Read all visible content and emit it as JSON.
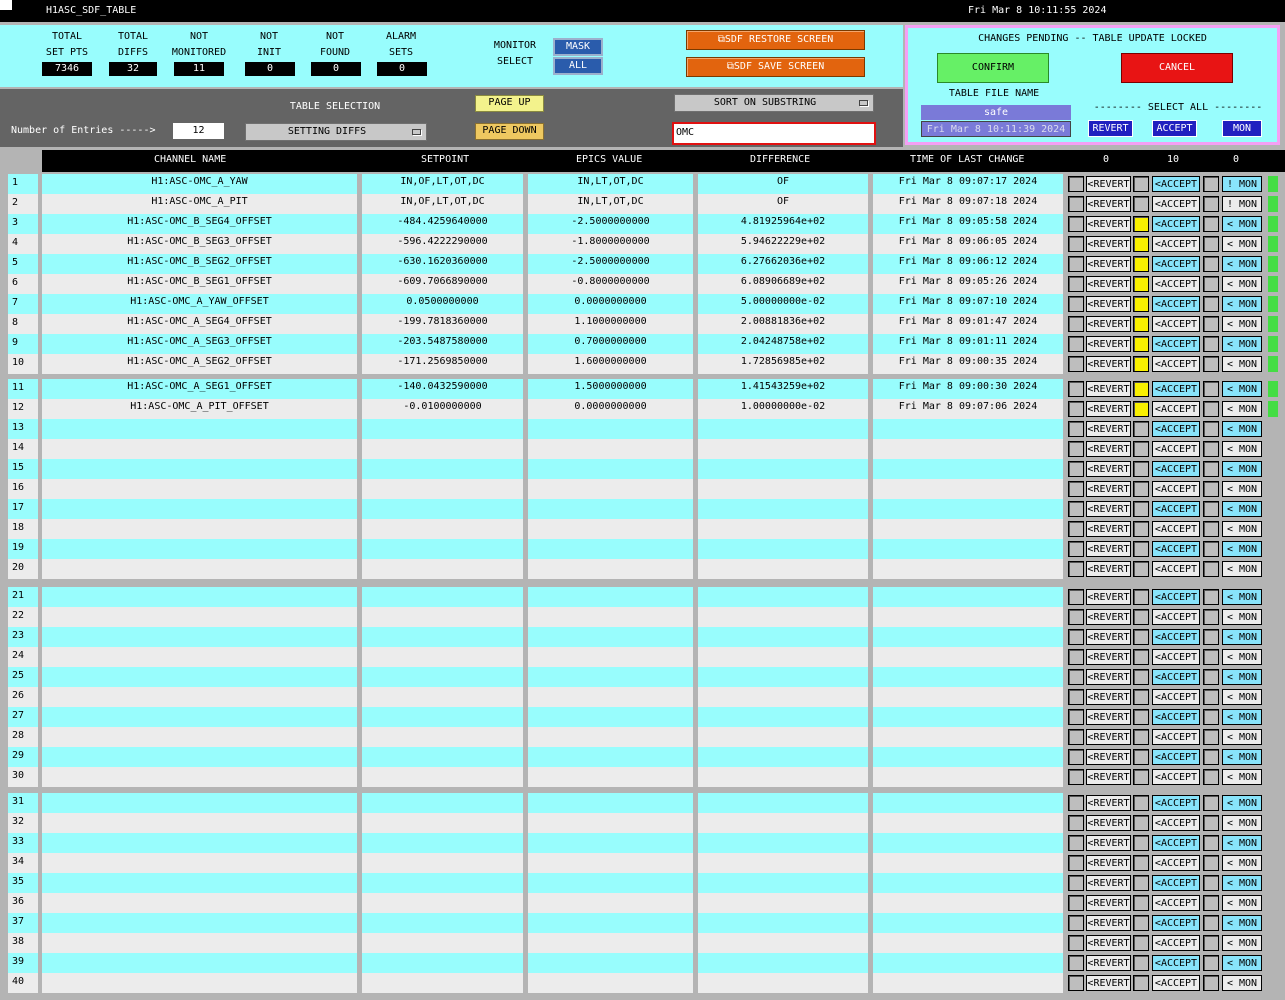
{
  "title_bar": {
    "name": "H1ASC_SDF_TABLE",
    "datetime": "Fri Mar  8 10:11:55 2024"
  },
  "stats": [
    {
      "label1": "TOTAL",
      "label2": "SET PTS",
      "value": "7346"
    },
    {
      "label1": "TOTAL",
      "label2": "DIFFS",
      "value": "32"
    },
    {
      "label1": "NOT",
      "label2": "MONITORED",
      "value": "11"
    },
    {
      "label1": "NOT",
      "label2": "INIT",
      "value": "0"
    },
    {
      "label1": "NOT",
      "label2": "FOUND",
      "value": "0"
    },
    {
      "label1": "ALARM",
      "label2": "SETS",
      "value": "0"
    }
  ],
  "monitor_select": {
    "label1": "MONITOR",
    "label2": "SELECT",
    "mask": "MASK",
    "all": "ALL"
  },
  "sdf_buttons": {
    "restore": "⧉SDF RESTORE SCREEN",
    "save": "⧉SDF SAVE SCREEN"
  },
  "pending": {
    "message": "CHANGES PENDING -- TABLE UPDATE LOCKED",
    "confirm": "CONFIRM",
    "cancel": "CANCEL",
    "table_file_label": "TABLE FILE NAME",
    "table_file": "safe",
    "table_file_time": "Fri Mar  8 10:11:39 2024",
    "select_all_label": "-------- SELECT ALL --------",
    "revert_all": "REVERT",
    "accept_all": "ACCEPT",
    "mon_all": "MON"
  },
  "controls": {
    "entries_label": "Number of Entries ----->",
    "entries_value": "12",
    "table_selection_label": "TABLE SELECTION",
    "table_selection": "SETTING DIFFS",
    "page_up": "PAGE UP",
    "page_down": "PAGE DOWN",
    "sort": "SORT ON SUBSTRING",
    "substring": "OMC"
  },
  "headers": {
    "channel": "CHANNEL NAME",
    "setpoint": "SETPOINT",
    "epics": "EPICS VALUE",
    "difference": "DIFFERENCE",
    "time": "TIME OF LAST CHANGE",
    "count_revert": "0",
    "count_accept": "10",
    "count_mon": "0"
  },
  "rows": [
    {
      "channel": "H1:ASC-OMC_A_YAW",
      "setpoint": "IN,OF,LT,OT,DC",
      "epics": "IN,LT,OT,DC",
      "diff": "OF",
      "time": "Fri Mar  8 09:07:17 2024"
    },
    {
      "channel": "H1:ASC-OMC_A_PIT",
      "setpoint": "IN,OF,LT,OT,DC",
      "epics": "IN,LT,OT,DC",
      "diff": "OF",
      "time": "Fri Mar  8 09:07:18 2024"
    },
    {
      "channel": "H1:ASC-OMC_B_SEG4_OFFSET",
      "setpoint": "-484.4259640000",
      "epics": "-2.5000000000",
      "diff": "4.81925964e+02",
      "time": "Fri Mar  8 09:05:58 2024"
    },
    {
      "channel": "H1:ASC-OMC_B_SEG3_OFFSET",
      "setpoint": "-596.4222290000",
      "epics": "-1.8000000000",
      "diff": "5.94622229e+02",
      "time": "Fri Mar  8 09:06:05 2024"
    },
    {
      "channel": "H1:ASC-OMC_B_SEG2_OFFSET",
      "setpoint": "-630.1620360000",
      "epics": "-2.5000000000",
      "diff": "6.27662036e+02",
      "time": "Fri Mar  8 09:06:12 2024"
    },
    {
      "channel": "H1:ASC-OMC_B_SEG1_OFFSET",
      "setpoint": "-609.7066890000",
      "epics": "-0.8000000000",
      "diff": "6.08906689e+02",
      "time": "Fri Mar  8 09:05:26 2024"
    },
    {
      "channel": "H1:ASC-OMC_A_YAW_OFFSET",
      "setpoint": "0.0500000000",
      "epics": "0.0000000000",
      "diff": "5.00000000e-02",
      "time": "Fri Mar  8 09:07:10 2024"
    },
    {
      "channel": "H1:ASC-OMC_A_SEG4_OFFSET",
      "setpoint": "-199.7818360000",
      "epics": "1.1000000000",
      "diff": "2.00881836e+02",
      "time": "Fri Mar  8 09:01:47 2024"
    },
    {
      "channel": "H1:ASC-OMC_A_SEG3_OFFSET",
      "setpoint": "-203.5487580000",
      "epics": "0.7000000000",
      "diff": "2.04248758e+02",
      "time": "Fri Mar  8 09:01:11 2024"
    },
    {
      "channel": "H1:ASC-OMC_A_SEG2_OFFSET",
      "setpoint": "-171.2569850000",
      "epics": "1.6000000000",
      "diff": "1.72856985e+02",
      "time": "Fri Mar  8 09:00:35 2024"
    },
    {
      "channel": "H1:ASC-OMC_A_SEG1_OFFSET",
      "setpoint": "-140.0432590000",
      "epics": "1.5000000000",
      "diff": "1.41543259e+02",
      "time": "Fri Mar  8 09:00:30 2024"
    },
    {
      "channel": "H1:ASC-OMC_A_PIT_OFFSET",
      "setpoint": "-0.0100000000",
      "epics": "0.0000000000",
      "diff": "1.00000000e-02",
      "time": "Fri Mar  8 09:07:06 2024"
    }
  ],
  "row_buttons": {
    "revert": "<REVERT",
    "accept": "<ACCEPT",
    "mon": "< MON",
    "unmon": "! MON"
  },
  "colors": {
    "cyan": "#98fdfd",
    "light_gray": "#ececec",
    "accept_blue": "#88e4fb",
    "confirm_green": "#66f066",
    "cancel_red": "#e81414",
    "pink_border": "#f4a0f4",
    "yellow_checkbox": "#f8f000"
  }
}
